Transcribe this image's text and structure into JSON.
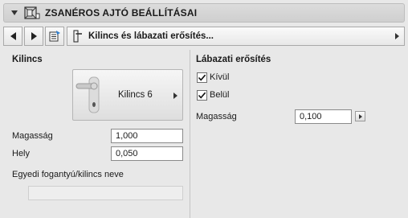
{
  "header": {
    "title": "ZSANÉROS AJTÓ BEÁLLÍTÁSAI",
    "icon": "door-settings-icon"
  },
  "toolbar": {
    "prev_icon": "previous-arrow-icon",
    "next_icon": "next-arrow-icon",
    "panel_icon": "panel-list-icon",
    "page_icon": "door-handle-icon",
    "page_label": "Kilincs és lábazati erősítés..."
  },
  "kilincs": {
    "heading": "Kilincs",
    "handle_name": "Kilincs 6",
    "height_label": "Magasság",
    "height_value": "1,000",
    "position_label": "Hely",
    "position_value": "0,050",
    "custom_name_label": "Egyedi fogantyú/kilincs neve",
    "custom_name_value": ""
  },
  "labazati": {
    "heading": "Lábazati erősítés",
    "outside_label": "Kívül",
    "outside_checked": true,
    "inside_label": "Belül",
    "inside_checked": true,
    "height_label": "Magasság",
    "height_value": "0,100"
  }
}
